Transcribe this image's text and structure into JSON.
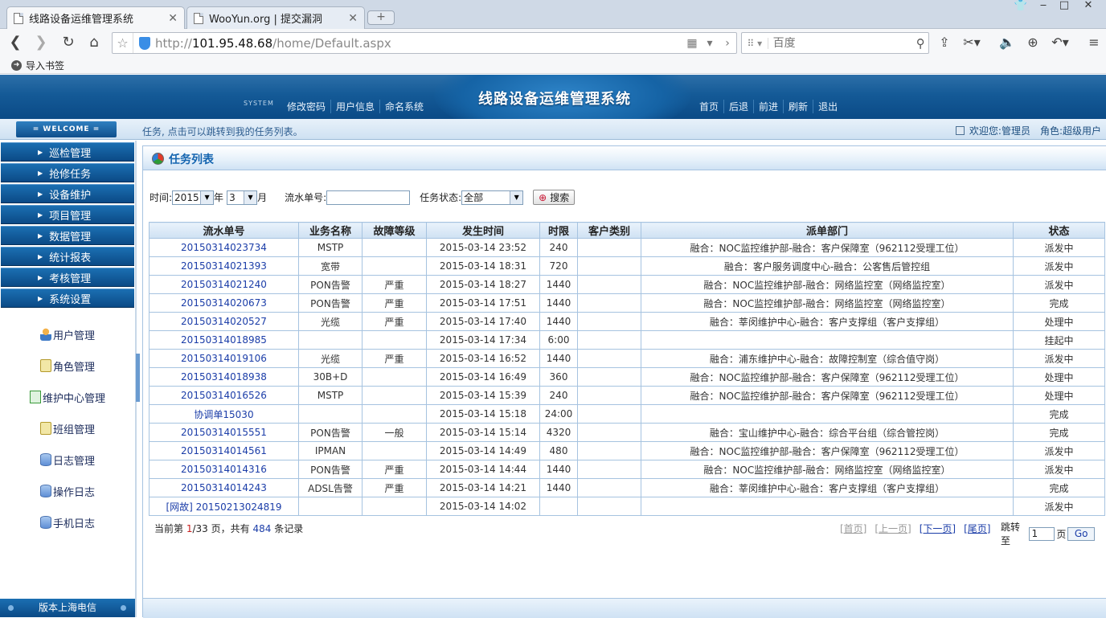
{
  "browser": {
    "tabs": [
      {
        "label": "线路设备运维管理系统",
        "active": true
      },
      {
        "label": "WooYun.org | 提交漏洞",
        "active": false
      }
    ],
    "url_prefix": "http://",
    "url_host": "101.95.48.68",
    "url_path": "/home/Default.aspx",
    "search_placeholder": "百度",
    "bookmark_import": "导入书签"
  },
  "app": {
    "title": "线路设备运维管理系统",
    "system_tag": "SYSTEM",
    "left_menu": [
      "修改密码",
      "用户信息",
      "命名系统"
    ],
    "right_menu": [
      "首页",
      "后退",
      "前进",
      "刷新",
      "退出"
    ],
    "welcome": "= WELCOME =",
    "hint": "任务, 点击可以跳转到我的任务列表。",
    "user_label": "欢迎您:管理员",
    "role_label": "角色:超级用户"
  },
  "sidebar": {
    "menus": [
      "巡检管理",
      "抢修任务",
      "设备维护",
      "项目管理",
      "数据管理",
      "统计报表",
      "考核管理",
      "系统设置"
    ],
    "items": [
      {
        "label": "用户管理",
        "icon": "user-icon"
      },
      {
        "label": "角色管理",
        "icon": "lock-icon"
      },
      {
        "label": "维护中心管理",
        "icon": "monitor-icon"
      },
      {
        "label": "班组管理",
        "icon": "lock-icon"
      },
      {
        "label": "日志管理",
        "icon": "database-icon"
      },
      {
        "label": "操作日志",
        "icon": "database-icon"
      },
      {
        "label": "手机日志",
        "icon": "database-icon"
      }
    ],
    "footer": "版本上海电信"
  },
  "panel": {
    "title": "任务列表",
    "filters": {
      "time_label": "时间:",
      "year": "2015",
      "year_unit": "年",
      "month": "3",
      "month_unit": "月",
      "serial_label": "流水单号:",
      "serial_value": "",
      "status_label": "任务状态:",
      "status_value": "全部",
      "search_button": "搜索"
    },
    "columns": [
      "流水单号",
      "业务名称",
      "故障等级",
      "发生时间",
      "时限",
      "客户类别",
      "派单部门",
      "状态"
    ],
    "rows": [
      [
        "20150314023734",
        "MSTP",
        "",
        "2015-03-14 23:52",
        "240",
        "",
        "融合：NOC监控维护部-融合：客户保障室（962112受理工位）",
        "派发中"
      ],
      [
        "20150314021393",
        "宽带",
        "",
        "2015-03-14 18:31",
        "720",
        "",
        "融合：客户服务调度中心-融合：公客售后管控组",
        "派发中"
      ],
      [
        "20150314021240",
        "PON告警",
        "严重",
        "2015-03-14 18:27",
        "1440",
        "",
        "融合：NOC监控维护部-融合：网络监控室（网络监控室）",
        "派发中"
      ],
      [
        "20150314020673",
        "PON告警",
        "严重",
        "2015-03-14 17:51",
        "1440",
        "",
        "融合：NOC监控维护部-融合：网络监控室（网络监控室）",
        "完成"
      ],
      [
        "20150314020527",
        "光缆",
        "严重",
        "2015-03-14 17:40",
        "1440",
        "",
        "融合：莘闵维护中心-融合：客户支撑组（客户支撑组）",
        "处理中"
      ],
      [
        "20150314018985",
        "",
        "",
        "2015-03-14 17:34",
        "6:00",
        "",
        "",
        "挂起中"
      ],
      [
        "20150314019106",
        "光缆",
        "严重",
        "2015-03-14 16:52",
        "1440",
        "",
        "融合：浦东维护中心-融合：故障控制室（综合值守岗）",
        "派发中"
      ],
      [
        "20150314018938",
        "30B+D",
        "",
        "2015-03-14 16:49",
        "360",
        "",
        "融合：NOC监控维护部-融合：客户保障室（962112受理工位）",
        "处理中"
      ],
      [
        "20150314016526",
        "MSTP",
        "",
        "2015-03-14 15:39",
        "240",
        "",
        "融合：NOC监控维护部-融合：客户保障室（962112受理工位）",
        "处理中"
      ],
      [
        "协调单15030",
        "",
        "",
        "2015-03-14 15:18",
        "24:00",
        "",
        "",
        "完成"
      ],
      [
        "20150314015551",
        "PON告警",
        "一般",
        "2015-03-14 15:14",
        "4320",
        "",
        "融合：宝山维护中心-融合：综合平台组（综合管控岗）",
        "完成"
      ],
      [
        "20150314014561",
        "IPMAN",
        "",
        "2015-03-14 14:49",
        "480",
        "",
        "融合：NOC监控维护部-融合：客户保障室（962112受理工位）",
        "派发中"
      ],
      [
        "20150314014316",
        "PON告警",
        "严重",
        "2015-03-14 14:44",
        "1440",
        "",
        "融合：NOC监控维护部-融合：网络监控室（网络监控室）",
        "派发中"
      ],
      [
        "20150314014243",
        "ADSL告警",
        "严重",
        "2015-03-14 14:21",
        "1440",
        "",
        "融合：莘闵维护中心-融合：客户支撑组（客户支撑组）",
        "完成"
      ],
      [
        "[网故] 20150213024819",
        "",
        "",
        "2015-03-14 14:02",
        "",
        "",
        "",
        "派发中"
      ]
    ],
    "pager": {
      "prefix": "当前第",
      "current": "1",
      "sep": "/33",
      "mid": "页，共有",
      "total": "484",
      "suffix": "条记录",
      "first": "[首页]",
      "prev": "[上一页]",
      "next": "[下一页]",
      "last": "[尾页]",
      "jump_label": "跳转至",
      "jump_value": "1",
      "page_unit": "页",
      "go": "Go"
    }
  }
}
